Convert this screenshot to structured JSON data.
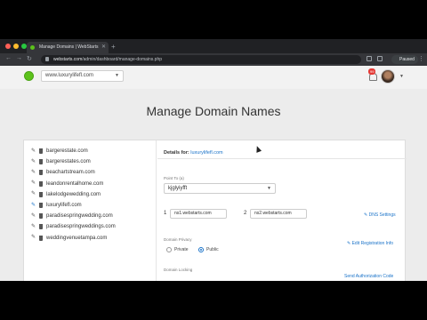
{
  "browser": {
    "tab_title": "Manage Domains | WebStarts",
    "url_domain": "webstarts.com",
    "url_path": "/admin/dashboard/manage-domains.php",
    "profile_label": "Paused"
  },
  "header": {
    "site_selector": "www.luxurylifefl.com",
    "notification_count": "99"
  },
  "main": {
    "title": "Manage Domain Names",
    "domains": [
      "bargerestate.com",
      "bargerestates.com",
      "beachartstream.com",
      "leandonrentalhome.com",
      "lakelodgewedding.com",
      "luxurylifefl.com",
      "paradisespringwedding.com",
      "paradisespringweddings.com",
      "weddingvenuetampa.com"
    ],
    "selected_domain_index": 5,
    "details": {
      "label": "Details for:",
      "domain": "luxurylifefl.com",
      "point_to_label": "Point To (a)",
      "point_to_value": "kjglyiyfft",
      "ns1_num": "1",
      "ns1_value": "ns1.webstarts.com",
      "ns2_num": "2",
      "ns2_value": "ns2.webstarts.com",
      "dns_link": "DNS Settings",
      "privacy_label": "Domain Privacy",
      "privacy_private": "Private",
      "privacy_public": "Public",
      "privacy_selected": "Public",
      "edit_registration_link": "Edit Registration Info",
      "locking_label": "Domain Locking",
      "auth_code_link": "Send Authorization Code"
    }
  },
  "colors": {
    "accent": "#1a73c9",
    "brand_green": "#5cc21b",
    "badge_red": "#e53935"
  }
}
